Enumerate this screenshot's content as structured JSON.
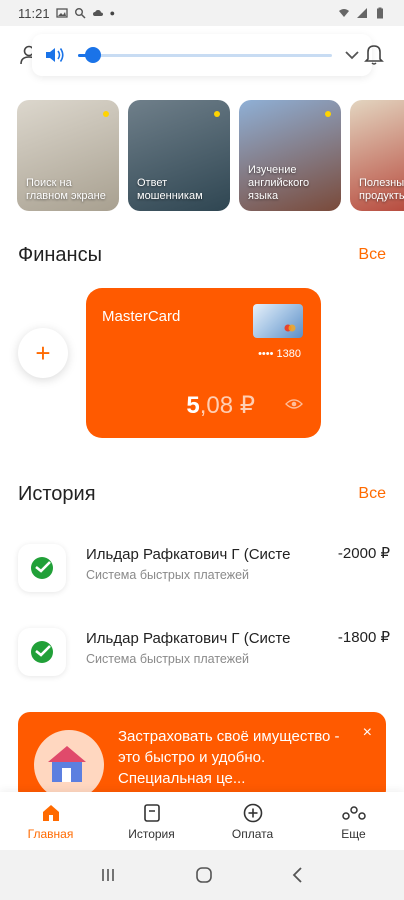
{
  "status_bar": {
    "time": "11:21"
  },
  "stories": [
    {
      "label": "Поиск на главном экране",
      "bg": "linear-gradient(160deg,#dcd7cd,#a8a090)"
    },
    {
      "label": "Ответ мошенникам",
      "bg": "linear-gradient(160deg,#6f7f8a,#2f4652)"
    },
    {
      "label": "Изучение английского языка",
      "bg": "linear-gradient(160deg,#8fb0d6,#7a4a3a)"
    },
    {
      "label": "Полезные продукты",
      "bg": "linear-gradient(160deg,#e3d5c0,#b23a2e)"
    }
  ],
  "finance": {
    "title": "Финансы",
    "all_link": "Все",
    "add_label": "+",
    "card": {
      "name": "MasterCard",
      "number_mask": "•••• 1380",
      "balance_int": "5",
      "balance_frac": ",08 ₽"
    }
  },
  "history": {
    "title": "История",
    "all_link": "Все",
    "items": [
      {
        "name": "Ильдар Рафкатович Г (Систе",
        "sub": "Система быстрых платежей",
        "amount": "-2000 ₽"
      },
      {
        "name": "Ильдар Рафкатович Г (Систе",
        "sub": "Система быстрых платежей",
        "amount": "-1800 ₽"
      }
    ]
  },
  "promo": {
    "text": "Застраховать своё имущество - это быстро и удобно. Специальная це...",
    "close": "×"
  },
  "bottom_nav": [
    {
      "label": "Главная",
      "icon": "home-icon"
    },
    {
      "label": "История",
      "icon": "history-icon"
    },
    {
      "label": "Оплата",
      "icon": "payment-icon"
    },
    {
      "label": "Еще",
      "icon": "more-icon"
    }
  ],
  "colors": {
    "accent": "#ff5a00",
    "accent_text": "#ff6a00",
    "volume": "#1a73e8"
  },
  "volume": {
    "level": 0.06
  }
}
